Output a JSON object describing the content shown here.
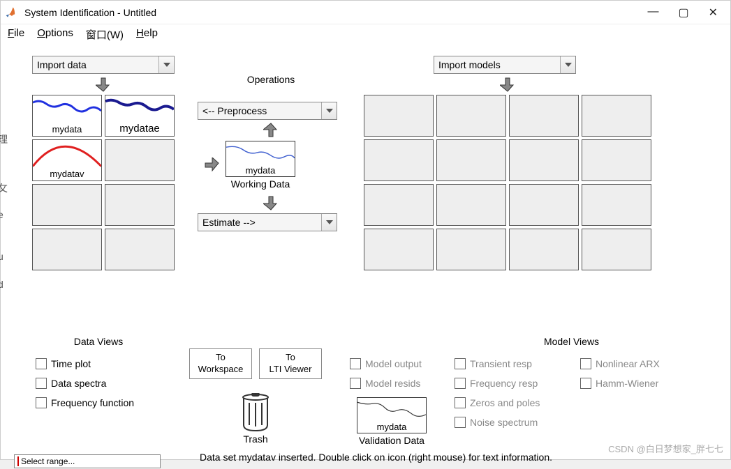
{
  "window": {
    "title": "System Identification - Untitled"
  },
  "menu": {
    "file": "File",
    "options": "Options",
    "window": "窗口(W)",
    "help": "Help"
  },
  "importData": "Import data",
  "importModels": "Import models",
  "operationsLabel": "Operations",
  "preprocess": "<-- Preprocess",
  "estimate": "Estimate -->",
  "workingData": {
    "name": "mydata",
    "label": "Working Data"
  },
  "validationData": {
    "name": "mydata",
    "label": "Validation Data"
  },
  "dataSlots": [
    {
      "name": "mydata",
      "curve": "blue-wave"
    },
    {
      "name": "mydatae",
      "curve": "darkblue-wave"
    },
    {
      "name": "mydatav",
      "curve": "red-arc"
    },
    {
      "name": ""
    },
    {
      "name": ""
    },
    {
      "name": ""
    },
    {
      "name": ""
    },
    {
      "name": ""
    }
  ],
  "dataViews": {
    "header": "Data Views",
    "items": [
      "Time plot",
      "Data spectra",
      "Frequency function"
    ]
  },
  "buttons": {
    "toWorkspace": "To\nWorkspace",
    "toLTI": "To\nLTI Viewer"
  },
  "trash": "Trash",
  "modelViews": {
    "header": "Model Views",
    "col1": [
      "Model output",
      "Model resids"
    ],
    "col2": [
      "Transient resp",
      "Frequency resp",
      "Zeros and poles",
      "Noise spectrum"
    ],
    "col3": [
      "Nonlinear ARX",
      "Hamm-Wiener"
    ]
  },
  "statusText": "Data set mydatav inserted.  Double click on icon (right mouse) for text information.",
  "watermark": "CSDN @白日梦想家_胖七七",
  "selectRange": "Select range...",
  "clipped": [
    "理",
    "攵",
    "e",
    "u",
    "d"
  ]
}
